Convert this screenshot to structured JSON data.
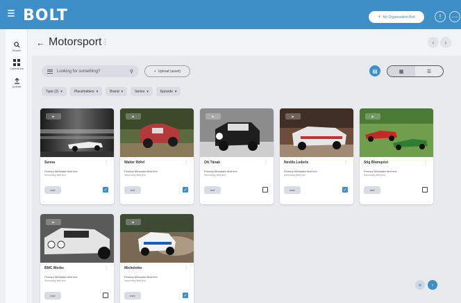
{
  "app": {
    "logo": "BOLT",
    "org_button": "My Organisation Bolt",
    "info_icon": "info-circle",
    "account_icon": "account-circle"
  },
  "sidebar": {
    "items": [
      {
        "label": "Search",
        "icon": "search-icon"
      },
      {
        "label": "Collections",
        "icon": "grid-icon"
      },
      {
        "label": "Upload",
        "icon": "upload-icon"
      }
    ]
  },
  "header": {
    "back": "←",
    "title": "Motorsport",
    "title_menu": "⋮",
    "prev": "‹",
    "next": "›"
  },
  "toolbar": {
    "search_placeholder": "Looking for something?",
    "upload_label": "Upload (asset)",
    "view_grid": "▦",
    "view_list": "☰"
  },
  "filters": [
    {
      "label": "Type (2)"
    },
    {
      "label": "Placeholders"
    },
    {
      "label": "Brand"
    },
    {
      "label": "Series"
    },
    {
      "label": "Episode"
    }
  ],
  "cards": [
    {
      "name": "Senna",
      "primary": "Primary Metadata field text",
      "secondary": "Secondary field text",
      "format": "mov",
      "checked": true
    },
    {
      "name": "Walter Röhrl",
      "primary": "Primary Metadata field text",
      "secondary": "Secondary field text",
      "format": "mxf",
      "checked": true
    },
    {
      "name": "Ott Tänak",
      "primary": "Primary Metadata field text",
      "secondary": "Secondary field text",
      "format": "mxf",
      "checked": false
    },
    {
      "name": "Neville Lederle",
      "primary": "Primary Metadata field text",
      "secondary": "Secondary field text",
      "format": "mov",
      "checked": true
    },
    {
      "name": "Stig Blomqvist",
      "primary": "Primary Metadata field text",
      "secondary": "Secondary field text",
      "format": "mxf",
      "checked": false
    },
    {
      "name": "BMC Works",
      "primary": "Primary Metadata field text",
      "secondary": "Secondary field text",
      "format": "mov",
      "checked": false
    },
    {
      "name": "Michelotto",
      "primary": "Primary Metadata field text",
      "secondary": "Secondary field text",
      "format": "mov",
      "checked": true
    }
  ],
  "colors": {
    "brand": "#3e8fc7",
    "chip": "#d9dce2",
    "check": "#3e8fc7"
  }
}
